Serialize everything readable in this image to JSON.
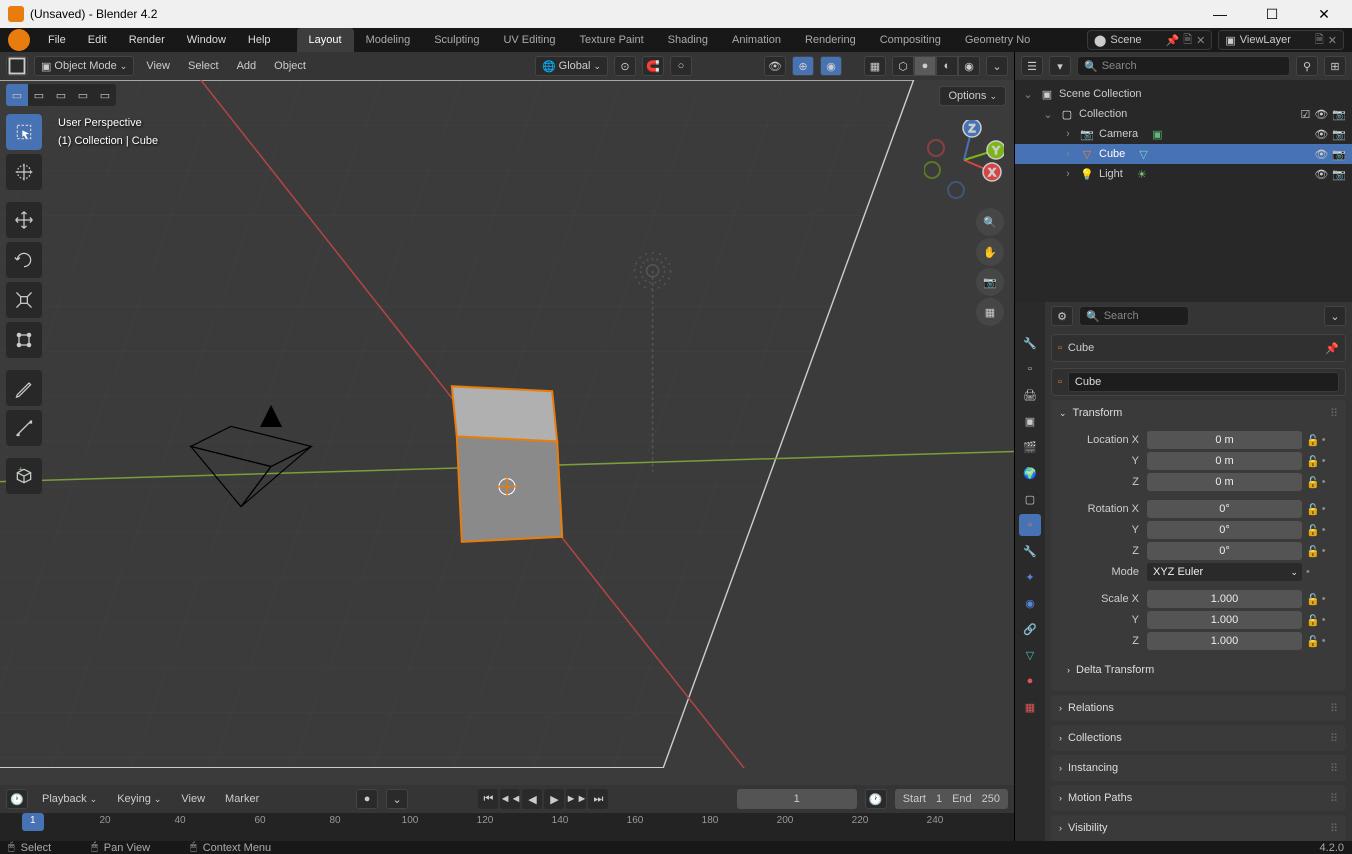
{
  "window": {
    "title": "(Unsaved) - Blender 4.2"
  },
  "menu": [
    "File",
    "Edit",
    "Render",
    "Window",
    "Help"
  ],
  "workspaces": [
    "Layout",
    "Modeling",
    "Sculpting",
    "UV Editing",
    "Texture Paint",
    "Shading",
    "Animation",
    "Rendering",
    "Compositing",
    "Geometry No"
  ],
  "active_workspace": "Layout",
  "scene": {
    "name": "Scene",
    "viewlayer": "ViewLayer"
  },
  "vp_header": {
    "mode": "Object Mode",
    "view": "View",
    "select": "Select",
    "add": "Add",
    "object": "Object",
    "orientation": "Global",
    "options": "Options"
  },
  "vp_info": {
    "l1": "User Perspective",
    "l2": "(1) Collection | Cube"
  },
  "outliner": {
    "search_placeholder": "Search",
    "root": "Scene Collection",
    "collection": "Collection",
    "items": [
      {
        "name": "Camera",
        "icon": "camera"
      },
      {
        "name": "Cube",
        "icon": "mesh",
        "selected": true
      },
      {
        "name": "Light",
        "icon": "light"
      }
    ]
  },
  "props": {
    "search_placeholder": "Search",
    "object_name": "Cube",
    "name_field": "Cube",
    "transform_label": "Transform",
    "location": {
      "label_x": "Location X",
      "x": "0 m",
      "y": "0 m",
      "z": "0 m"
    },
    "rotation": {
      "label_x": "Rotation X",
      "x": "0°",
      "y": "0°",
      "z": "0°"
    },
    "mode_label": "Mode",
    "mode_value": "XYZ Euler",
    "scale": {
      "label_x": "Scale X",
      "x": "1.000",
      "y": "1.000",
      "z": "1.000"
    },
    "delta": "Delta Transform",
    "panels": [
      "Relations",
      "Collections",
      "Instancing",
      "Motion Paths",
      "Visibility"
    ]
  },
  "timeline": {
    "playback": "Playback",
    "keying": "Keying",
    "view": "View",
    "marker": "Marker",
    "current": "1",
    "start_label": "Start",
    "start": "1",
    "end_label": "End",
    "end": "250",
    "ticks": [
      "1",
      "20",
      "40",
      "60",
      "80",
      "100",
      "120",
      "140",
      "160",
      "180",
      "200",
      "220",
      "240"
    ]
  },
  "status": {
    "select": "Select",
    "pan": "Pan View",
    "context": "Context Menu",
    "version": "4.2.0"
  },
  "axis_labels": {
    "x": "X",
    "y": "Y",
    "z": "Z"
  },
  "yz_labels": {
    "y": "Y",
    "z": "Z"
  }
}
